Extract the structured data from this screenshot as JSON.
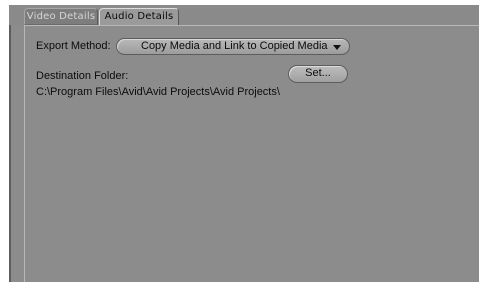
{
  "tabs": [
    {
      "label": "Video Details",
      "active": false
    },
    {
      "label": "Audio Details",
      "active": true
    }
  ],
  "export_method": {
    "label": "Export Method:",
    "selected": "Copy Media and Link to Copied Media"
  },
  "destination": {
    "label": "Destination Folder:",
    "path": "C:\\Program Files\\Avid\\Avid Projects\\Avid Projects\\",
    "set_button_label": "Set..."
  },
  "colors": {
    "panel_background": "#8c8c8c",
    "active_tab": "#9a9a9a",
    "inactive_tab": "#7d7d7d"
  }
}
